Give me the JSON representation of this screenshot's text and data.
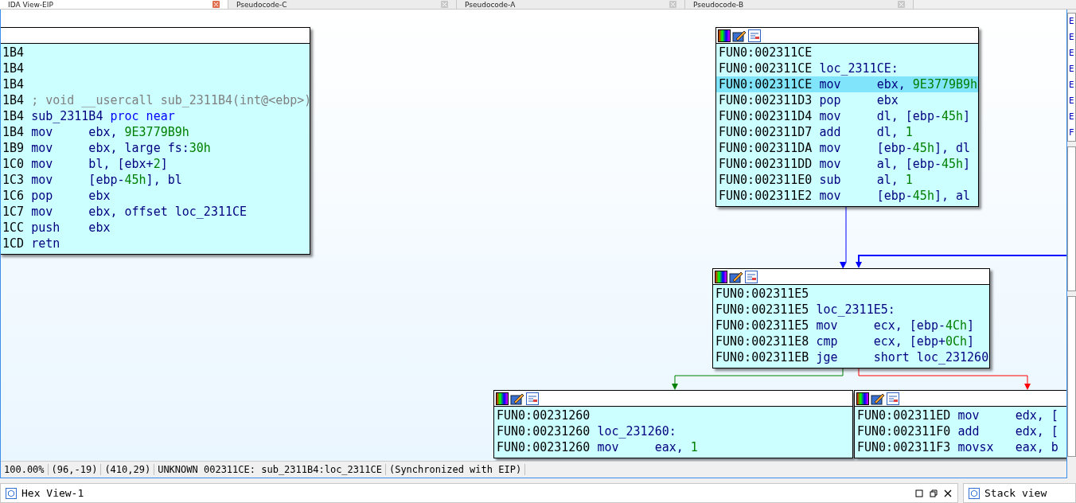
{
  "tabs": [
    {
      "label": "IDA View-EIP",
      "selected": true
    },
    {
      "label": "Pseudocode-C",
      "selected": false
    },
    {
      "label": "Pseudocode-A",
      "selected": false
    },
    {
      "label": "Pseudocode-B",
      "selected": false
    }
  ],
  "nodes": [
    {
      "lines": [
        {
          "addr": "1B4",
          "selected": false
        },
        {
          "addr": "1B4",
          "selected": false
        },
        {
          "addr": "1B4",
          "selected": false
        },
        {
          "addr": "1B4",
          "selected": false,
          "ops": [
            {
              "t": "; void __usercall sub_2311B4(int@<ebp>)",
              "kind": "comment"
            }
          ]
        },
        {
          "addr": "1B4",
          "selected": false,
          "ops": [
            {
              "t": "sub_2311B4 ",
              "kind": "name"
            },
            {
              "t": "proc near",
              "kind": "kw"
            }
          ]
        },
        {
          "addr": "1B4",
          "mnem": "mov",
          "selected": false,
          "ops": [
            {
              "t": "ebx, ",
              "kind": "reg"
            },
            {
              "t": "9E3779B9h",
              "kind": "num"
            }
          ]
        },
        {
          "addr": "1B9",
          "mnem": "mov",
          "selected": false,
          "ops": [
            {
              "t": "ebx, large fs:",
              "kind": "reg"
            },
            {
              "t": "30h",
              "kind": "num"
            }
          ]
        },
        {
          "addr": "1C0",
          "mnem": "mov",
          "selected": false,
          "ops": [
            {
              "t": "bl, [ebx+",
              "kind": "reg"
            },
            {
              "t": "2",
              "kind": "num"
            },
            {
              "t": "]",
              "kind": "reg"
            }
          ]
        },
        {
          "addr": "1C3",
          "mnem": "mov",
          "selected": false,
          "ops": [
            {
              "t": "[ebp-",
              "kind": "reg"
            },
            {
              "t": "45h",
              "kind": "num"
            },
            {
              "t": "], bl",
              "kind": "reg"
            }
          ]
        },
        {
          "addr": "1C6",
          "mnem": "pop",
          "selected": false,
          "ops": [
            {
              "t": "ebx",
              "kind": "reg"
            }
          ]
        },
        {
          "addr": "1C7",
          "mnem": "mov",
          "selected": false,
          "ops": [
            {
              "t": "ebx, offset loc_2311CE",
              "kind": "reg"
            }
          ]
        },
        {
          "addr": "1CC",
          "mnem": "push",
          "selected": false,
          "ops": [
            {
              "t": "ebx",
              "kind": "reg"
            }
          ]
        },
        {
          "addr": "1CD",
          "mnem": "retn",
          "selected": false
        }
      ]
    },
    {
      "lines": [
        {
          "addr": "FUN0:002311CE",
          "selected": false
        },
        {
          "addr": "FUN0:002311CE",
          "selected": false,
          "ops": [
            {
              "t": "loc_2311CE:",
              "kind": "name"
            }
          ]
        },
        {
          "addr": "FUN0:002311CE",
          "mnem": "mov",
          "selected": true,
          "ops": [
            {
              "t": "ebx, ",
              "kind": "reg"
            },
            {
              "t": "9E3779B9h",
              "kind": "num"
            }
          ]
        },
        {
          "addr": "FUN0:002311D3",
          "mnem": "pop",
          "selected": false,
          "ops": [
            {
              "t": "ebx",
              "kind": "reg"
            }
          ]
        },
        {
          "addr": "FUN0:002311D4",
          "mnem": "mov",
          "selected": false,
          "ops": [
            {
              "t": "dl, [ebp-",
              "kind": "reg"
            },
            {
              "t": "45h",
              "kind": "num"
            },
            {
              "t": "]",
              "kind": "reg"
            }
          ]
        },
        {
          "addr": "FUN0:002311D7",
          "mnem": "add",
          "selected": false,
          "ops": [
            {
              "t": "dl, ",
              "kind": "reg"
            },
            {
              "t": "1",
              "kind": "num"
            }
          ]
        },
        {
          "addr": "FUN0:002311DA",
          "mnem": "mov",
          "selected": false,
          "ops": [
            {
              "t": "[ebp-",
              "kind": "reg"
            },
            {
              "t": "45h",
              "kind": "num"
            },
            {
              "t": "], dl",
              "kind": "reg"
            }
          ]
        },
        {
          "addr": "FUN0:002311DD",
          "mnem": "mov",
          "selected": false,
          "ops": [
            {
              "t": "al, [ebp-",
              "kind": "reg"
            },
            {
              "t": "45h",
              "kind": "num"
            },
            {
              "t": "]",
              "kind": "reg"
            }
          ]
        },
        {
          "addr": "FUN0:002311E0",
          "mnem": "sub",
          "selected": false,
          "ops": [
            {
              "t": "al, ",
              "kind": "reg"
            },
            {
              "t": "1",
              "kind": "num"
            }
          ]
        },
        {
          "addr": "FUN0:002311E2",
          "mnem": "mov",
          "selected": false,
          "ops": [
            {
              "t": "[ebp-",
              "kind": "reg"
            },
            {
              "t": "45h",
              "kind": "num"
            },
            {
              "t": "], al",
              "kind": "reg"
            }
          ]
        }
      ]
    },
    {
      "lines": [
        {
          "addr": "FUN0:002311E5",
          "selected": false
        },
        {
          "addr": "FUN0:002311E5",
          "selected": false,
          "ops": [
            {
              "t": "loc_2311E5:",
              "kind": "name"
            }
          ]
        },
        {
          "addr": "FUN0:002311E5",
          "mnem": "mov",
          "selected": false,
          "ops": [
            {
              "t": "ecx, [ebp-",
              "kind": "reg"
            },
            {
              "t": "4Ch",
              "kind": "num"
            },
            {
              "t": "]",
              "kind": "reg"
            }
          ]
        },
        {
          "addr": "FUN0:002311E8",
          "mnem": "cmp",
          "selected": false,
          "ops": [
            {
              "t": "ecx, [ebp+",
              "kind": "reg"
            },
            {
              "t": "0Ch",
              "kind": "num"
            },
            {
              "t": "]",
              "kind": "reg"
            }
          ]
        },
        {
          "addr": "FUN0:002311EB",
          "mnem": "jge",
          "selected": false,
          "ops": [
            {
              "t": "short loc_231260",
              "kind": "reg"
            }
          ]
        }
      ]
    },
    {
      "lines": [
        {
          "addr": "FUN0:00231260",
          "selected": false
        },
        {
          "addr": "FUN0:00231260",
          "selected": false,
          "ops": [
            {
              "t": "loc_231260:",
              "kind": "name"
            }
          ]
        },
        {
          "addr": "FUN0:00231260",
          "mnem": "mov",
          "selected": false,
          "ops": [
            {
              "t": "eax, ",
              "kind": "reg"
            },
            {
              "t": "1",
              "kind": "num"
            }
          ]
        }
      ]
    },
    {
      "lines": [
        {
          "addr": "FUN0:002311ED",
          "mnem": "mov",
          "selected": false,
          "ops": [
            {
              "t": "edx, [",
              "kind": "reg"
            }
          ]
        },
        {
          "addr": "FUN0:002311F0",
          "mnem": "add",
          "selected": false,
          "ops": [
            {
              "t": "edx, [",
              "kind": "reg"
            }
          ]
        },
        {
          "addr": "FUN0:002311F3",
          "mnem": "movsx",
          "selected": false,
          "ops": [
            {
              "t": "eax, b",
              "kind": "reg"
            }
          ]
        }
      ]
    }
  ],
  "status_bar": [
    "100.00%",
    "(96,-19)",
    "(410,29)",
    "UNKNOWN 002311CE: sub_2311B4:loc_2311CE",
    "(Synchronized with EIP)"
  ],
  "register_strip": [
    "E",
    "E",
    "E",
    "E",
    "E",
    "E",
    "E",
    "F"
  ],
  "bottom_panels": [
    {
      "title": "Hex View-1"
    },
    {
      "title": "Stack view"
    }
  ]
}
